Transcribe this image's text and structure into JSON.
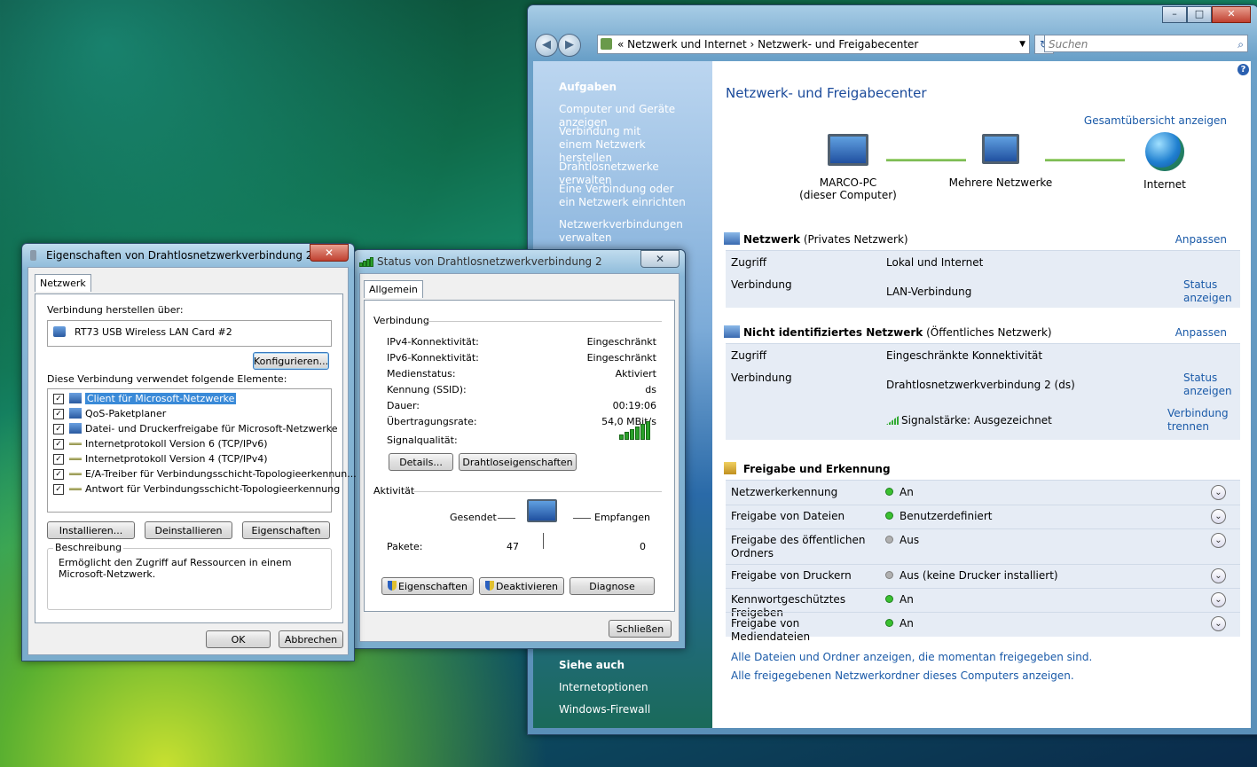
{
  "explorer": {
    "address_crumbs": "«  Netzwerk und Internet  ›  Netzwerk- und Freigabecenter",
    "search_placeholder": "Suchen",
    "sidebar": {
      "tasks_heading": "Aufgaben",
      "tasks": [
        "Computer und Geräte anzeigen",
        "Verbindung mit einem Netzwerk herstellen",
        "Drahtlosnetzwerke verwalten",
        "Eine Verbindung oder ein Netzwerk einrichten",
        "Netzwerkverbindungen verwalten"
      ],
      "see_also_heading": "Siehe auch",
      "see_also": [
        "Internetoptionen",
        "Windows-Firewall"
      ]
    },
    "title": "Netzwerk- und Freigabecenter",
    "overview_link": "Gesamtübersicht anzeigen",
    "map": {
      "pc_line1": "MARCO-PC",
      "pc_line2": "(dieser Computer)",
      "multi": "Mehrere Netzwerke",
      "internet": "Internet"
    },
    "net1": {
      "name": "Netzwerk",
      "type": "(Privates Netzwerk)",
      "customize": "Anpassen",
      "access_label": "Zugriff",
      "access_value": "Lokal und Internet",
      "conn_label": "Verbindung",
      "conn_value": "LAN-Verbindung",
      "status_link": "Status anzeigen"
    },
    "net2": {
      "name": "Nicht identifiziertes Netzwerk",
      "type": "(Öffentliches Netzwerk)",
      "customize": "Anpassen",
      "access_label": "Zugriff",
      "access_value": "Eingeschränkte Konnektivität",
      "conn_label": "Verbindung",
      "conn_value": "Drahtlosnetzwerkverbindung 2 (ds)",
      "status_link": "Status anzeigen",
      "signal": "Signalstärke: Ausgezeichnet",
      "disconnect_link": "Verbindung trennen"
    },
    "sharing": {
      "heading": "Freigabe und Erkennung",
      "rows": [
        {
          "label": "Netzwerkerkennung",
          "value": "An",
          "state": "on"
        },
        {
          "label": "Freigabe von Dateien",
          "value": "Benutzerdefiniert",
          "state": "on"
        },
        {
          "label": "Freigabe des öffentlichen Ordners",
          "value": "Aus",
          "state": "off"
        },
        {
          "label": "Freigabe von Druckern",
          "value": "Aus (keine Drucker installiert)",
          "state": "off"
        },
        {
          "label": "Kennwortgeschütztes Freigeben",
          "value": "An",
          "state": "on"
        },
        {
          "label": "Freigabe von Mediendateien",
          "value": "An",
          "state": "on"
        }
      ],
      "link1": "Alle Dateien und Ordner anzeigen, die momentan freigegeben sind.",
      "link2": "Alle freigegebenen Netzwerkordner dieses Computers anzeigen."
    }
  },
  "props_dialog": {
    "title": "Eigenschaften von Drahtlosnetzwerkverbindung 2",
    "tab": "Netzwerk",
    "connect_using_label": "Verbindung herstellen über:",
    "adapter": "RT73 USB Wireless LAN Card #2",
    "configure_btn": "Konfigurieren...",
    "items_label": "Diese Verbindung verwendet folgende Elemente:",
    "items": [
      "Client für Microsoft-Netzwerke",
      "QoS-Paketplaner",
      "Datei- und Druckerfreigabe für Microsoft-Netzwerke",
      "Internetprotokoll Version 6 (TCP/IPv6)",
      "Internetprotokoll Version 4 (TCP/IPv4)",
      "E/A-Treiber für Verbindungsschicht-Topologieerkennun...",
      "Antwort für Verbindungsschicht-Topologieerkennung"
    ],
    "install_btn": "Installieren...",
    "uninstall_btn": "Deinstallieren",
    "properties_btn": "Eigenschaften",
    "desc_label": "Beschreibung",
    "desc_text_1": "Ermöglicht den Zugriff auf Ressourcen in einem",
    "desc_text_2": "Microsoft-Netzwerk.",
    "ok_btn": "OK",
    "cancel_btn": "Abbrechen"
  },
  "status_dialog": {
    "title": "Status von Drahtlosnetzwerkverbindung 2",
    "tab": "Allgemein",
    "conn_heading": "Verbindung",
    "rows": [
      {
        "label": "IPv4-Konnektivität:",
        "value": "Eingeschränkt"
      },
      {
        "label": "IPv6-Konnektivität:",
        "value": "Eingeschränkt"
      },
      {
        "label": "Medienstatus:",
        "value": "Aktiviert"
      },
      {
        "label": "Kennung (SSID):",
        "value": "ds"
      },
      {
        "label": "Dauer:",
        "value": "00:19:06"
      },
      {
        "label": "Übertragungsrate:",
        "value": "54,0 MBit/s"
      }
    ],
    "signal_label": "Signalqualität:",
    "details_btn": "Details...",
    "wireless_btn": "Drahtloseigenschaften",
    "activity_heading": "Aktivität",
    "sent_label": "Gesendet",
    "received_label": "Empfangen",
    "packets_label": "Pakete:",
    "packets_sent": "47",
    "packets_received": "0",
    "properties_btn": "Eigenschaften",
    "disable_btn": "Deaktivieren",
    "diagnose_btn": "Diagnose",
    "close_btn": "Schließen"
  }
}
